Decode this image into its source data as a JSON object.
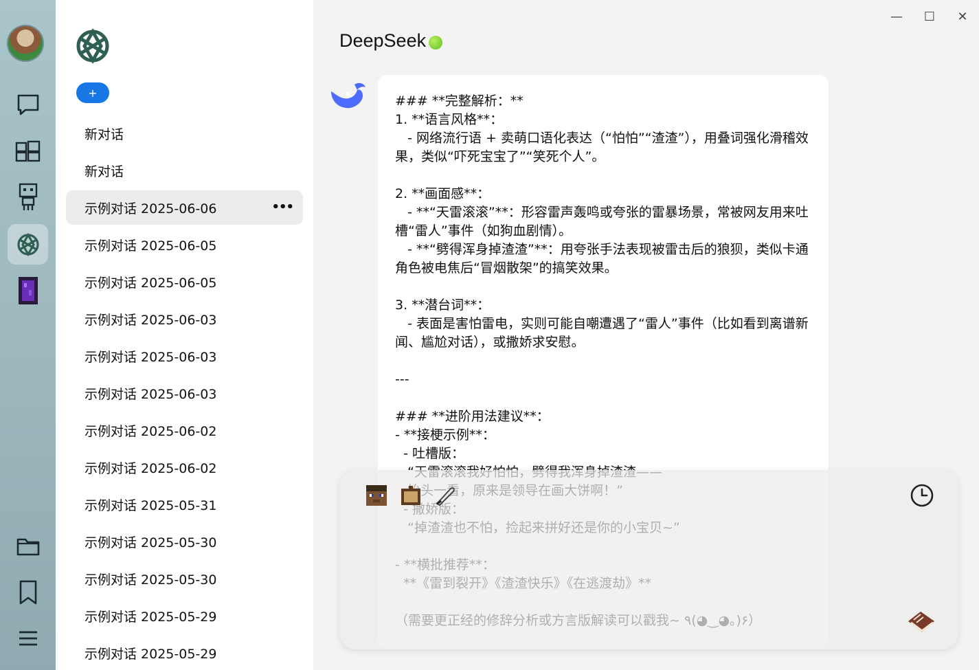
{
  "window": {
    "minimize": "—",
    "maximize": "☐",
    "close": "✕"
  },
  "rail": {
    "items": [
      "avatar",
      "chat-icon",
      "blocks-icon",
      "robot-icon",
      "openai-logo-icon",
      "portal-icon",
      "folder-icon",
      "bookmark-icon",
      "menu-icon"
    ],
    "active": "openai-logo-icon"
  },
  "sidebar": {
    "new_button": "+",
    "conversations": [
      {
        "label": "新对话"
      },
      {
        "label": "新对话"
      },
      {
        "label": "示例对话 2025-06-06",
        "selected": true,
        "more": "•••"
      },
      {
        "label": "示例对话 2025-06-05"
      },
      {
        "label": "示例对话 2025-06-05"
      },
      {
        "label": "示例对话 2025-06-03"
      },
      {
        "label": "示例对话 2025-06-03"
      },
      {
        "label": "示例对话 2025-06-03"
      },
      {
        "label": "示例对话 2025-06-02"
      },
      {
        "label": "示例对话 2025-06-02"
      },
      {
        "label": "示例对话 2025-05-31"
      },
      {
        "label": "示例对话 2025-05-30"
      },
      {
        "label": "示例对话 2025-05-30"
      },
      {
        "label": "示例对话 2025-05-29"
      },
      {
        "label": "示例对话 2025-05-29"
      }
    ]
  },
  "chat": {
    "title": "DeepSeek",
    "status_color": "#6fcf2a",
    "message": "### **完整解析：**\n1. **语言风格**：\n   - 网络流行语 + 卖萌口语化表达（“怕怕”“渣渣”），用叠词强化滑稽效果，类似“吓死宝宝了”“笑死个人”。\n\n2. **画面感**：\n   - **“天雷滚滚”**：形容雷声轰鸣或夸张的雷暴场景，常被网友用来吐槽“雷人”事件（如狗血剧情）。\n   - **“劈得浑身掉渣渣”**：用夸张手法表现被雷击后的狼狈，类似卡通角色被电焦后“冒烟散架”的搞笑效果。\n\n3. **潜台词**：\n   - 表面是害怕雷电，实则可能自嘲遭遇了“雷人”事件（比如看到离谱新闻、尴尬对话），或撒娇求安慰。\n\n---\n\n### **进阶用法建议**：\n- **接梗示例**：\n  - 吐槽版：\n   “天雷滚滚我好怕怕，劈得我浑身掉渣渣——\n   抬头一看，原来是领导在画大饼啊！”\n  - 撒娇版：\n   “掉渣渣也不怕，捡起来拼好还是你的小宝贝~”\n\n- **横批推荐**：\n  **《雷到裂开》《渣渣快乐》《在逃渡劫》**\n\n（需要更正经的修辞分析或方言版解读可以戳我~ ٩(◕‿◕｡)۶）"
  },
  "input": {
    "tools": [
      "steve-head-icon",
      "painting-icon",
      "quill-icon"
    ],
    "history": "clock-icon",
    "send": "book-icon"
  }
}
